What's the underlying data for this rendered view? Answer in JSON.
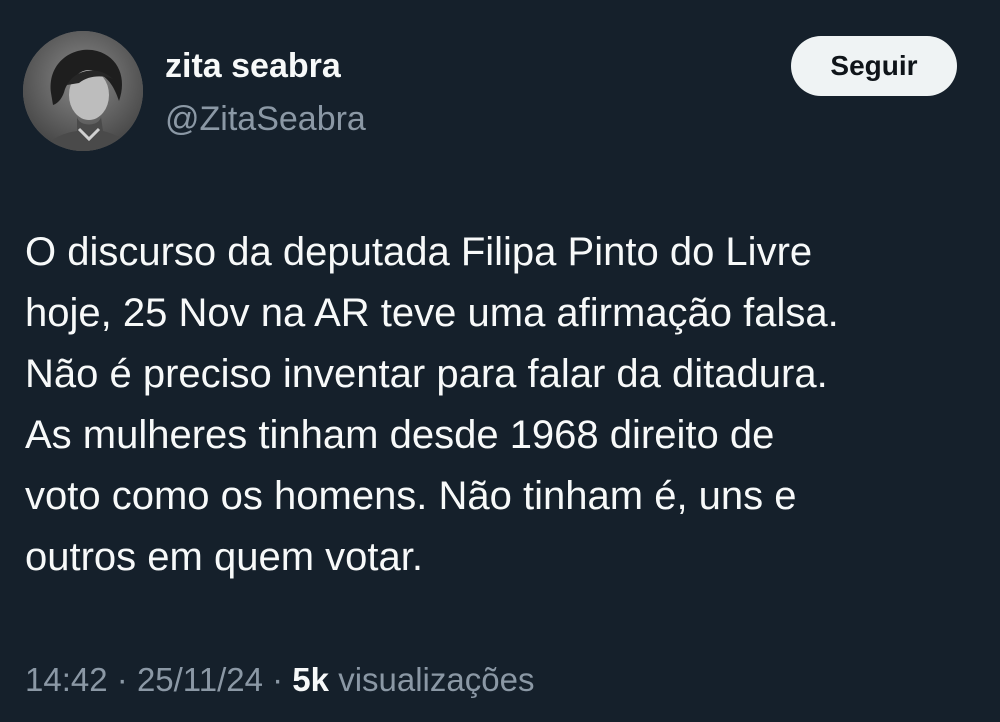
{
  "author": {
    "display_name": "zita seabra",
    "handle": "@ZitaSeabra"
  },
  "follow_button": {
    "label": "Seguir"
  },
  "tweet": {
    "lines": [
      "O discurso da deputada Filipa Pinto do Livre",
      "hoje, 25 Nov na AR teve uma afirmação falsa.",
      "Não é preciso inventar para falar da ditadura.",
      "As mulheres tinham desde 1968 direito de",
      "voto como os homens. Não tinham é, uns e",
      "outros em quem votar."
    ]
  },
  "meta": {
    "time": "14:42",
    "separator": "·",
    "date": "25/11/24",
    "views_count": "5k",
    "views_label": "visualizações"
  },
  "colors": {
    "background": "#15202b",
    "primary_text": "#f7f9f9",
    "secondary_text": "#8b98a5",
    "button_bg": "#eff3f4",
    "button_text": "#0f1419"
  },
  "icons": {
    "avatar": "profile-photo"
  }
}
